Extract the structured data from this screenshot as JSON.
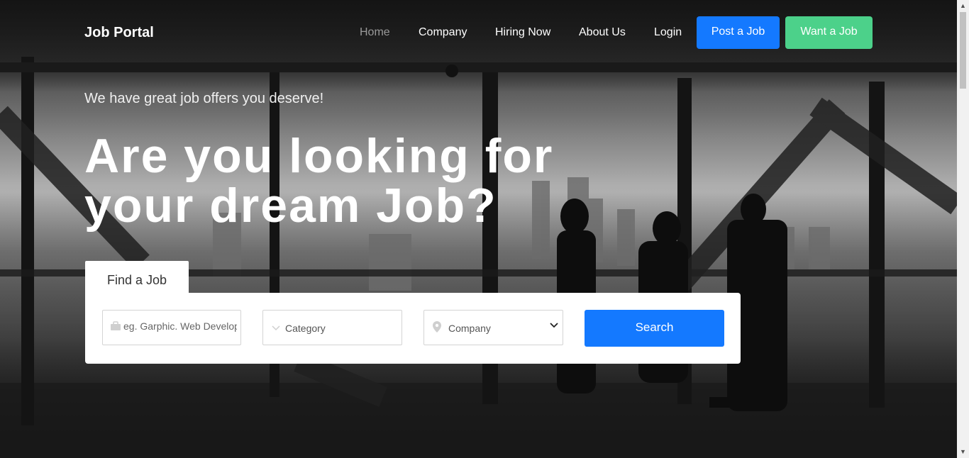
{
  "header": {
    "logo": "Job Portal",
    "nav": [
      {
        "label": "Home",
        "active": true
      },
      {
        "label": "Company"
      },
      {
        "label": "Hiring Now"
      },
      {
        "label": "About Us"
      },
      {
        "label": "Login"
      }
    ],
    "post_job_label": "Post a Job",
    "want_job_label": "Want a Job"
  },
  "hero": {
    "tagline": "We have great job offers you deserve!",
    "headline_line1": "Are you looking for",
    "headline_line2": "your dream Job?"
  },
  "search": {
    "tab_label": "Find a Job",
    "keyword_placeholder": "eg. Garphic. Web Developer",
    "category_label": "Category",
    "company_label": "Company",
    "button_label": "Search"
  },
  "colors": {
    "primary": "#1479ff",
    "secondary": "#4cd18a"
  }
}
